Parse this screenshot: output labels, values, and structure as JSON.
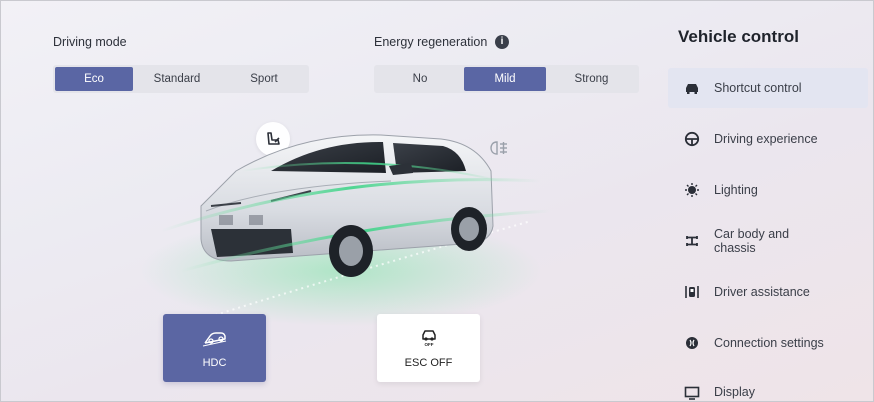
{
  "driving_mode": {
    "label": "Driving mode",
    "options": [
      "Eco",
      "Standard",
      "Sport"
    ],
    "selected": "Eco"
  },
  "energy_regeneration": {
    "label": "Energy regeneration",
    "info_icon": "info-icon",
    "options": [
      "No",
      "Mild",
      "Strong"
    ],
    "selected": "Mild"
  },
  "car_view": {
    "top_buttons": [
      {
        "icon": "seat-icon"
      },
      {
        "icon": "fog-light-icon"
      }
    ]
  },
  "quick_tiles": [
    {
      "label": "HDC",
      "icon": "hill-descent-icon",
      "active": true
    },
    {
      "label": "ESC OFF",
      "icon": "esc-off-icon",
      "active": false
    }
  ],
  "sidebar": {
    "title": "Vehicle control",
    "items": [
      {
        "label": "Shortcut control",
        "icon": "car-icon"
      },
      {
        "label": "Driving experience",
        "icon": "steering-wheel-icon"
      },
      {
        "label": "Lighting",
        "icon": "light-icon"
      },
      {
        "label": "Car body and chassis",
        "icon": "chassis-icon"
      },
      {
        "label": "Driver assistance",
        "icon": "driver-assist-icon"
      },
      {
        "label": "Connection settings",
        "icon": "connection-icon"
      },
      {
        "label": "Display",
        "icon": "display-icon"
      }
    ],
    "active_index": 0
  },
  "colors": {
    "accent": "#5a66a4",
    "active_bg": "#e3e5f1",
    "segment_bg": "#e4e4ea"
  }
}
